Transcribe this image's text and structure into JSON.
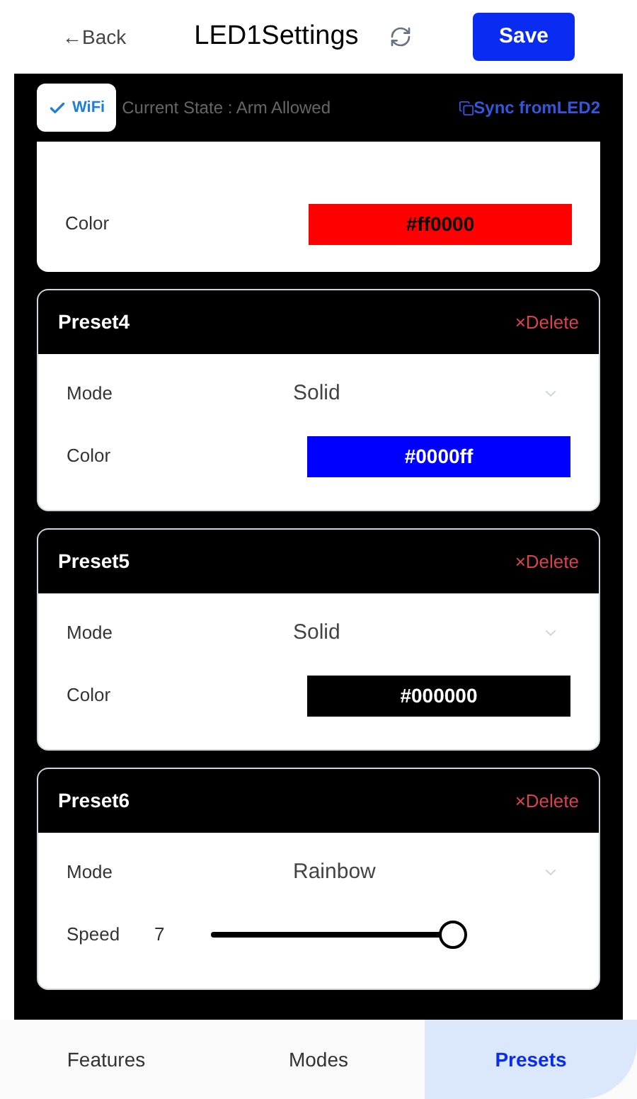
{
  "header": {
    "back": "←Back",
    "title": "LED1Settings",
    "save": "Save"
  },
  "status_bar": {
    "wifi": {
      "label": "WiFi",
      "checked": true
    },
    "state": "Current State : Arm Allowed",
    "sync": "Sync fromLED2"
  },
  "presets": [
    {
      "rows": [
        {
          "kind": "color",
          "label": "Color",
          "value": "#ff0000",
          "color": "#ff0000"
        }
      ]
    },
    {
      "name": "Preset4",
      "delete": "×Delete",
      "rows": [
        {
          "kind": "select",
          "label": "Mode",
          "value": "Solid"
        },
        {
          "kind": "color",
          "label": "Color",
          "value": "#0000ff",
          "color": "#0000ff"
        }
      ]
    },
    {
      "name": "Preset5",
      "delete": "×Delete",
      "rows": [
        {
          "kind": "select",
          "label": "Mode",
          "value": "Solid"
        },
        {
          "kind": "color",
          "label": "Color",
          "value": "#000000",
          "color": "#000000"
        }
      ]
    },
    {
      "name": "Preset6",
      "delete": "×Delete",
      "rows": [
        {
          "kind": "select",
          "label": "Mode",
          "value": "Rainbow"
        },
        {
          "kind": "slider",
          "label": "Speed",
          "value": "7",
          "level": 0.95
        }
      ]
    }
  ],
  "tabs": [
    {
      "label": "Features",
      "selected": false
    },
    {
      "label": "Modes",
      "selected": false
    },
    {
      "label": "Presets",
      "selected": true
    }
  ]
}
